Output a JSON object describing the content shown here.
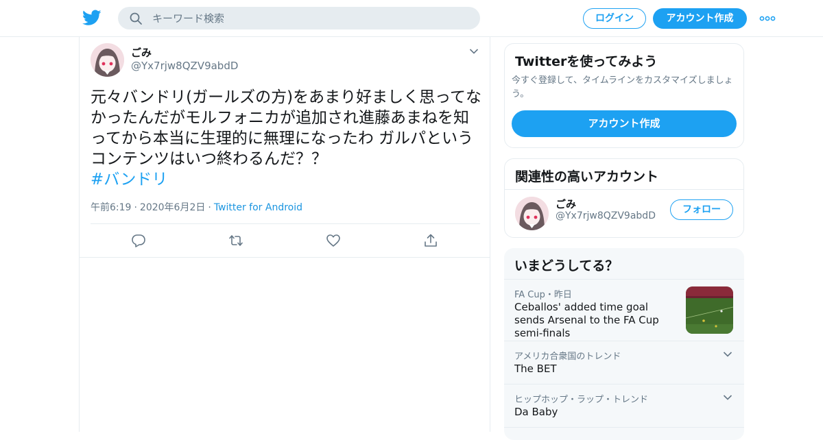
{
  "header": {
    "search_placeholder": "キーワード検索",
    "login_label": "ログイン",
    "signup_label": "アカウント作成"
  },
  "tweet": {
    "author_name": "ごみ",
    "author_handle": "@Yx7rjw8QZV9abdD",
    "text": "元々バンドリ(ガールズの方)をあまり好ましく思ってなかったんだがモルフォニカが追加され進藤あまねを知ってから本当に生理的に無理になったわ ガルパというコンテンツはいつ終わるんだ？？",
    "hashtag": "#バンドリ",
    "time": "午前6:19",
    "date": "2020年6月2日",
    "client": "Twitter for Android"
  },
  "signup_card": {
    "title": "Twitterを使ってみよう",
    "description": "今すぐ登録して、タイムラインをカスタマイズしましょう。",
    "button_label": "アカウント作成"
  },
  "related_card": {
    "title": "関連性の高いアカウント",
    "account_name": "ごみ",
    "account_handle": "@Yx7rjw8QZV9abdD",
    "follow_label": "フォロー"
  },
  "trends_card": {
    "title": "いまどうしてる？",
    "items": [
      {
        "meta": "FA Cup・昨日",
        "name": "Ceballos' added time goal sends Arsenal to the FA Cup semi-finals"
      },
      {
        "meta": "アメリカ合衆国のトレンド",
        "name": "The BET"
      },
      {
        "meta": "ヒップホップ・ラップ・トレンド",
        "name": "Da Baby"
      }
    ]
  },
  "colors": {
    "brand_blue": "#1da1f2",
    "link_blue": "#1b95e0",
    "secondary_text": "#657786",
    "border": "#e6ecf0"
  }
}
